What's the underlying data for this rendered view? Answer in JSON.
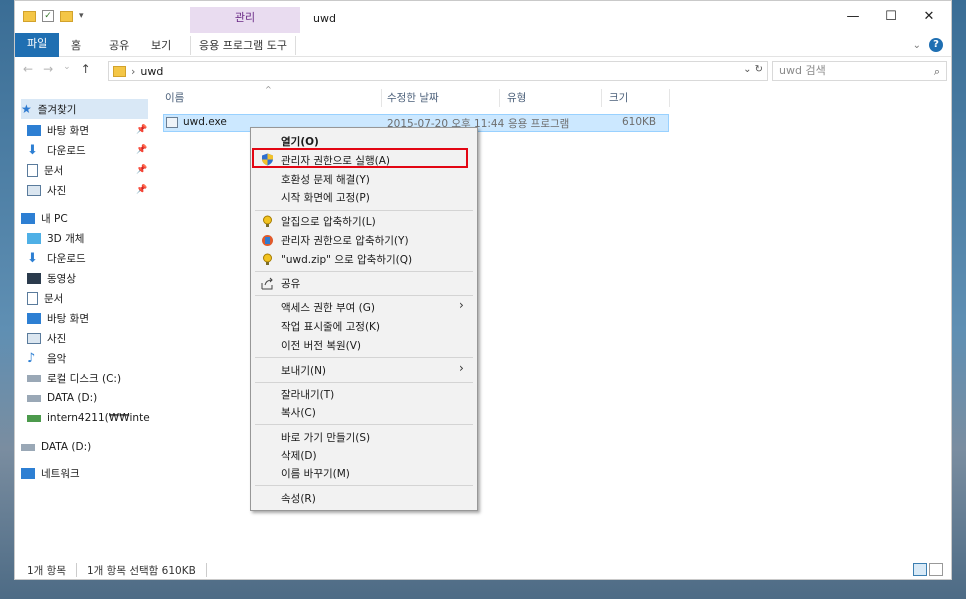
{
  "titlebar": {
    "context_tab": "관리",
    "title": "uwd",
    "minimize_icon": "minimize-icon",
    "maximize_icon": "maximize-icon",
    "close_icon": "close-icon"
  },
  "ribbon": {
    "tabs": [
      "파일",
      "홈",
      "공유",
      "보기",
      "응용 프로그램 도구"
    ]
  },
  "address": {
    "crumb": "uwd",
    "search_placeholder": "uwd 검색"
  },
  "nav": {
    "quick_access": "즐겨찾기",
    "quick_items": [
      "바탕 화면",
      "다운로드",
      "문서",
      "사진"
    ],
    "this_pc": "내 PC",
    "pc_items": [
      "3D 개체",
      "다운로드",
      "동영상",
      "문서",
      "바탕 화면",
      "사진",
      "음악",
      "로컬 디스크 (C:)",
      "DATA (D:)",
      "intern4211(₩₩inte"
    ],
    "data_drive": "DATA (D:)",
    "network": "네트워크"
  },
  "columns": {
    "name": "이름",
    "modified": "수정한 날짜",
    "type": "유형",
    "size": "크기"
  },
  "files": [
    {
      "name": "uwd.exe",
      "modified": "2015-07-20 오후 11:44",
      "type": "응용 프로그램",
      "size": "610KB"
    }
  ],
  "context_menu": {
    "items": [
      "열기(O)",
      "관리자 권한으로 실행(A)",
      "호환성 문제 해결(Y)",
      "시작 화면에 고정(P)",
      "알집으로 압축하기(L)",
      "관리자 권한으로 압축하기(Y)",
      "\"uwd.zip\" 으로 압축하기(Q)",
      "공유",
      "액세스 권한 부여 (G)",
      "작업 표시줄에 고정(K)",
      "이전 버전 복원(V)",
      "보내기(N)",
      "잘라내기(T)",
      "복사(C)",
      "바로 가기 만들기(S)",
      "삭제(D)",
      "이름 바꾸기(M)",
      "속성(R)"
    ],
    "highlight_color": "#e30613"
  },
  "status": {
    "count": "1개 항목",
    "selection": "1개 항목 선택함 610KB"
  }
}
